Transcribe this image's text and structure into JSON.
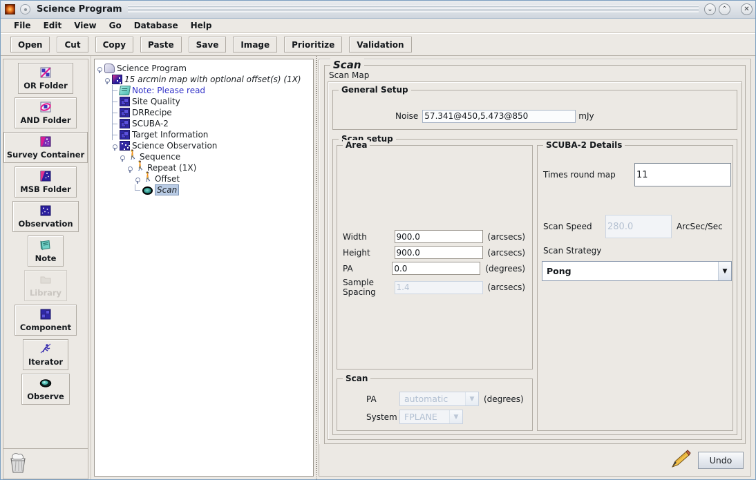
{
  "window": {
    "title": "Science Program",
    "app_icon": "flame-icon",
    "buttons": [
      {
        "name": "minimize-button",
        "glyph": "⌄"
      },
      {
        "name": "maximize-button",
        "glyph": "⌃"
      },
      {
        "name": "close-button",
        "glyph": "✕"
      }
    ]
  },
  "menubar": {
    "items": [
      "File",
      "Edit",
      "View",
      "Go",
      "Database",
      "Help"
    ]
  },
  "toolbar": {
    "buttons": [
      "Open",
      "Cut",
      "Copy",
      "Paste",
      "Save",
      "Image",
      "Prioritize",
      "Validation"
    ]
  },
  "palette": {
    "items": [
      {
        "label": "OR Folder",
        "icon": "or-folder-icon",
        "enabled": true
      },
      {
        "label": "AND Folder",
        "icon": "and-folder-icon",
        "enabled": true
      },
      {
        "label": "Survey Container",
        "icon": "survey-container-icon",
        "enabled": true
      },
      {
        "label": "MSB Folder",
        "icon": "msb-folder-icon",
        "enabled": true
      },
      {
        "label": "Observation",
        "icon": "observation-icon",
        "enabled": true
      },
      {
        "label": "Note",
        "icon": "note-icon",
        "enabled": true
      },
      {
        "label": "Library",
        "icon": "library-icon",
        "enabled": false
      },
      {
        "label": "Component",
        "icon": "component-icon",
        "enabled": true
      },
      {
        "label": "Iterator",
        "icon": "iterator-icon",
        "enabled": true
      },
      {
        "label": "Observe",
        "icon": "observe-eye-icon",
        "enabled": true
      }
    ],
    "trash": "trash-bin-icon"
  },
  "tree": {
    "nodes": [
      {
        "label": "Science Program",
        "icon": "science-program-icon",
        "depth": 0,
        "expander": true,
        "style": "plain"
      },
      {
        "label": "15 arcmin map with optional offset(s) (1X)",
        "icon": "msb-folder-icon",
        "depth": 1,
        "expander": true,
        "style": "italic"
      },
      {
        "label": "Note: Please read",
        "icon": "note-icon",
        "depth": 2,
        "expander": false,
        "style": "note"
      },
      {
        "label": "Site Quality",
        "icon": "component-icon",
        "depth": 2,
        "expander": false,
        "style": "plain"
      },
      {
        "label": "DRRecipe",
        "icon": "component-icon",
        "depth": 2,
        "expander": false,
        "style": "plain"
      },
      {
        "label": "SCUBA-2",
        "icon": "component-icon",
        "depth": 2,
        "expander": false,
        "style": "plain"
      },
      {
        "label": "Target Information",
        "icon": "component-icon",
        "depth": 2,
        "expander": false,
        "style": "plain"
      },
      {
        "label": "Science Observation",
        "icon": "observation-icon",
        "depth": 2,
        "expander": true,
        "style": "plain"
      },
      {
        "label": "Sequence",
        "icon": "iterator-icon",
        "depth": 3,
        "expander": true,
        "style": "plain"
      },
      {
        "label": "Repeat (1X)",
        "icon": "iterator-icon",
        "depth": 4,
        "expander": true,
        "style": "plain"
      },
      {
        "label": "Offset",
        "icon": "iterator-icon",
        "depth": 5,
        "expander": true,
        "style": "plain"
      },
      {
        "label": "Scan",
        "icon": "observe-eye-icon",
        "depth": 6,
        "expander": false,
        "style": "selected"
      }
    ]
  },
  "editor": {
    "title": "Scan",
    "subtitle": "Scan Map",
    "general_setup": {
      "title": "General Setup",
      "noise_label": "Noise",
      "noise_value": "57.341@450,5.473@850",
      "noise_unit": "mJy"
    },
    "scan_setup": {
      "title": "Scan setup",
      "area": {
        "title": "Area",
        "fields": [
          {
            "label": "Width",
            "value": "900.0",
            "unit": "(arcsecs)",
            "enabled": true
          },
          {
            "label": "Height",
            "value": "900.0",
            "unit": "(arcsecs)",
            "enabled": true
          },
          {
            "label": "PA",
            "value": "0.0",
            "unit": "(degrees)",
            "enabled": true
          },
          {
            "label": "Sample Spacing",
            "value": "1.4",
            "unit": "(arcsecs)",
            "enabled": false
          }
        ]
      },
      "scan": {
        "title": "Scan",
        "pa_label": "PA",
        "pa_value": "automatic",
        "pa_unit": "(degrees)",
        "system_label": "System",
        "system_value": "FPLANE"
      },
      "scuba2": {
        "title": "SCUBA-2 Details",
        "times_round_map_label": "Times round map",
        "times_round_map_value": "11",
        "scan_speed_label": "Scan Speed",
        "scan_speed_value": "280.0",
        "scan_speed_unit": "ArcSec/Sec",
        "scan_strategy_label": "Scan Strategy",
        "scan_strategy_value": "Pong"
      }
    }
  },
  "footer": {
    "pencil_icon": "pencil-icon",
    "undo_label": "Undo"
  }
}
